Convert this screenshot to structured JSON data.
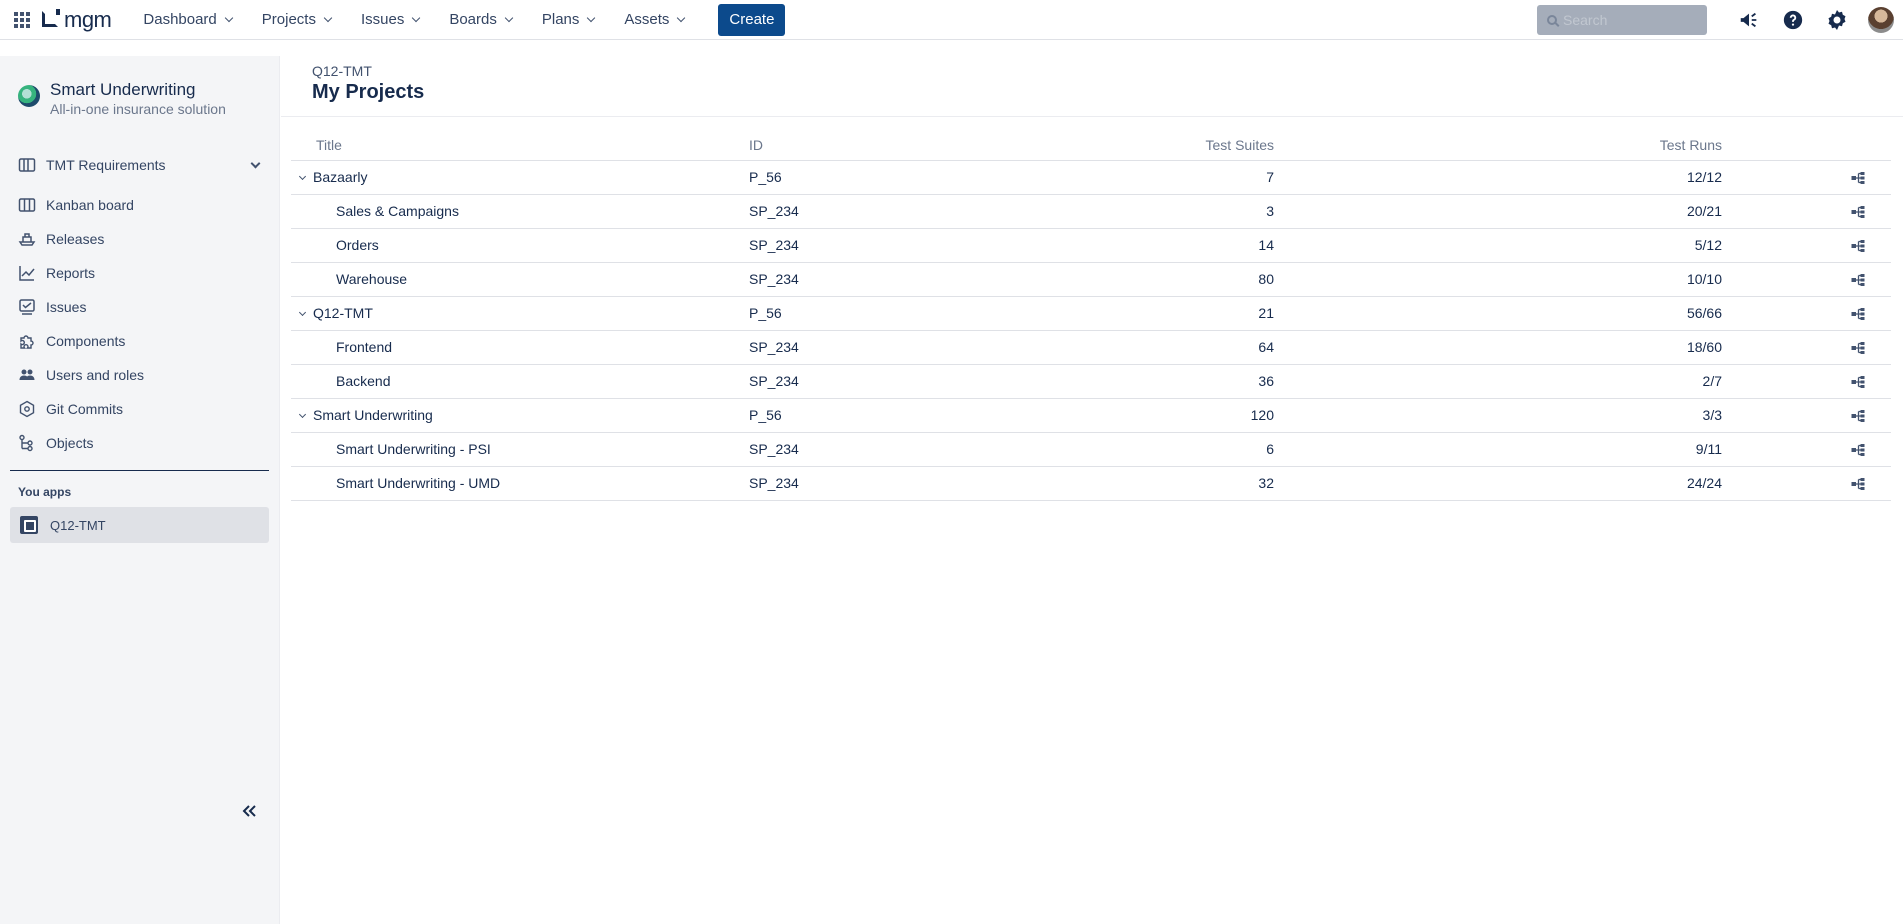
{
  "topbar": {
    "logo_text": "mgm",
    "nav": [
      {
        "label": "Dashboard"
      },
      {
        "label": "Projects"
      },
      {
        "label": "Issues"
      },
      {
        "label": "Boards"
      },
      {
        "label": "Plans"
      },
      {
        "label": "Assets"
      }
    ],
    "create_label": "Create",
    "search_placeholder": "Search",
    "icons": [
      "notifications-icon",
      "help-icon",
      "settings-icon",
      "avatar"
    ]
  },
  "sidebar": {
    "project_name": "Smart Underwriting",
    "project_subtitle": "All-in-one insurance solution",
    "section_label": "TMT Requirements",
    "items": [
      {
        "label": "Kanban board",
        "icon": "kanban-icon"
      },
      {
        "label": "Releases",
        "icon": "releases-icon"
      },
      {
        "label": "Reports",
        "icon": "reports-icon"
      },
      {
        "label": "Issues",
        "icon": "issues-icon"
      },
      {
        "label": "Components",
        "icon": "components-icon"
      },
      {
        "label": "Users and roles",
        "icon": "users-icon"
      },
      {
        "label": "Git Commits",
        "icon": "git-icon"
      },
      {
        "label": "Objects",
        "icon": "objects-icon"
      }
    ],
    "apps_heading": "You apps",
    "app_item": "Q12-TMT"
  },
  "main": {
    "breadcrumb": "Q12-TMT",
    "title": "My Projects",
    "columns": {
      "title": "Title",
      "id": "ID",
      "suites": "Test Suites",
      "runs": "Test Runs"
    },
    "rows": [
      {
        "title": "Bazaarly",
        "id": "P_56",
        "suites": "7",
        "runs": "12/12",
        "parent": true
      },
      {
        "title": "Sales & Campaigns",
        "id": "SP_234",
        "suites": "3",
        "runs": "20/21",
        "parent": false
      },
      {
        "title": "Orders",
        "id": "SP_234",
        "suites": "14",
        "runs": "5/12",
        "parent": false
      },
      {
        "title": "Warehouse",
        "id": "SP_234",
        "suites": "80",
        "runs": "10/10",
        "parent": false
      },
      {
        "title": "Q12-TMT",
        "id": "P_56",
        "suites": "21",
        "runs": "56/66",
        "parent": true
      },
      {
        "title": "Frontend",
        "id": "SP_234",
        "suites": "64",
        "runs": "18/60",
        "parent": false
      },
      {
        "title": "Backend",
        "id": "SP_234",
        "suites": "36",
        "runs": "2/7",
        "parent": false
      },
      {
        "title": "Smart Underwriting",
        "id": "P_56",
        "suites": "120",
        "runs": "3/3",
        "parent": true
      },
      {
        "title": "Smart Underwriting - PSI",
        "id": "SP_234",
        "suites": "6",
        "runs": "9/11",
        "parent": false
      },
      {
        "title": "Smart Underwriting - UMD",
        "id": "SP_234",
        "suites": "32",
        "runs": "24/24",
        "parent": false
      }
    ]
  },
  "colors": {
    "primary": "#0c4a8c",
    "text": "#172b4d",
    "sidebar_bg": "#f4f5f7"
  }
}
